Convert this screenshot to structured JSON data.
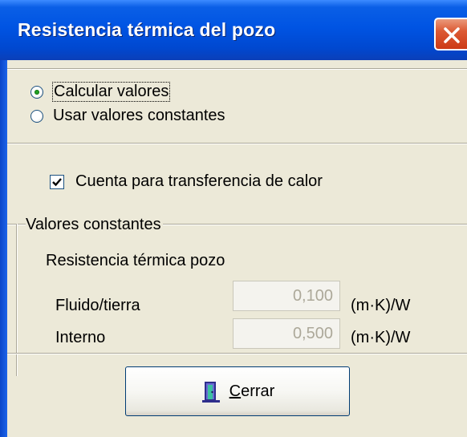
{
  "window": {
    "title": "Resistencia térmica del pozo",
    "close_glyph": "×"
  },
  "mode": {
    "options": [
      {
        "label": "Calcular valores",
        "selected": true
      },
      {
        "label": "Usar valores constantes",
        "selected": false
      }
    ]
  },
  "heat_transfer": {
    "label": "Cuenta para transferencia de calor",
    "checked": true
  },
  "constants": {
    "group_title": "Valores constantes",
    "section_label": "Resistencia térmica pozo",
    "rows": [
      {
        "label": "Fluido/tierra",
        "value": "0,100",
        "unit": "(m·K)/W",
        "enabled": false
      },
      {
        "label": "Interno",
        "value": "0,500",
        "unit": "(m·K)/W",
        "enabled": false
      }
    ]
  },
  "buttons": {
    "close_label": "Cerrar",
    "close_icon": "door-exit-icon"
  },
  "colors": {
    "titlebar": "#0054e3",
    "dialog_bg": "#ece9d8",
    "close_button": "#dc5a34",
    "radio_dot": "#21a121",
    "disabled_text": "#aca899"
  }
}
